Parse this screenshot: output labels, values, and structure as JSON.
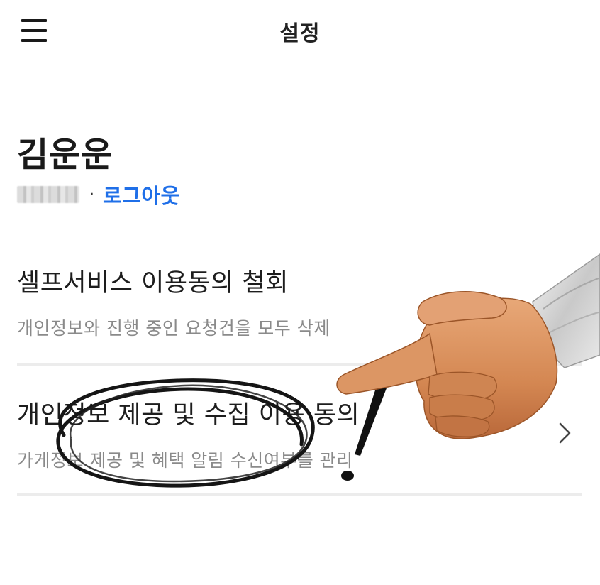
{
  "header": {
    "title": "설정",
    "menu_icon": "hamburger-menu-icon"
  },
  "profile": {
    "name": "김운운",
    "separator": "·",
    "logout_label": "로그아웃"
  },
  "menu": {
    "items": [
      {
        "title": "셀프서비스 이용동의 철회",
        "subtitle": "개인정보와 진행 중인 요청건을 모두 삭제"
      },
      {
        "title": "개인정보 제공 및 수집 이용 동의",
        "subtitle": "가게정보 제공 및 혜택 알림 수신여부를 관리",
        "icon": "chevron-right-icon"
      }
    ]
  },
  "colors": {
    "link": "#1f6fe8",
    "divider": "#ececec",
    "subtitle": "#8a8a8a"
  }
}
